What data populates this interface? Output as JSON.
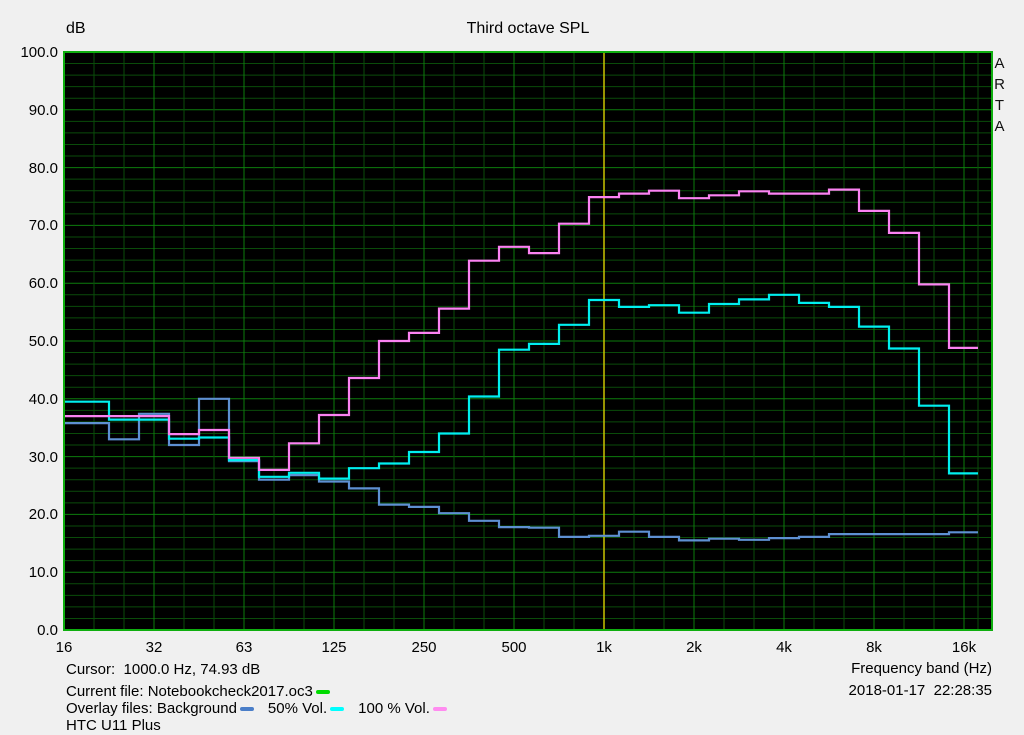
{
  "window": {
    "background": "#f0f0f0",
    "plot_background": "#000000"
  },
  "branding": {
    "vertical_label": "ARTA"
  },
  "chart_data": {
    "type": "step-line",
    "title": "Third octave SPL",
    "ylabel": "dB",
    "xlabel": "Frequency band (Hz)",
    "ylim": [
      0.0,
      100.0
    ],
    "grid": {
      "visible": true,
      "minor_color": "#0a4b0a",
      "major_color": "#0d7c0d",
      "border_color": "#0fae0f"
    },
    "y_tick_labels": [
      "100.0",
      "90.0",
      "80.0",
      "70.0",
      "60.0",
      "50.0",
      "40.0",
      "30.0",
      "20.0",
      "10.0",
      "0.0"
    ],
    "x_tick_labels": [
      "16",
      "32",
      "63",
      "125",
      "250",
      "500",
      "1k",
      "2k",
      "4k",
      "8k",
      "16k"
    ],
    "categories": [
      "16",
      "20",
      "25",
      "31.5",
      "40",
      "50",
      "63",
      "80",
      "100",
      "125",
      "160",
      "200",
      "250",
      "315",
      "400",
      "500",
      "630",
      "800",
      "1k",
      "1.25k",
      "1.6k",
      "2k",
      "2.5k",
      "3.15k",
      "4k",
      "5k",
      "6.3k",
      "8k",
      "10k",
      "12.5k",
      "16k"
    ],
    "series": [
      {
        "name": "Background",
        "color": "#5e90d2",
        "values": [
          35.8,
          35.8,
          33.0,
          37.4,
          32.0,
          40.0,
          29.2,
          26.0,
          26.8,
          25.7,
          24.5,
          21.7,
          21.3,
          20.2,
          18.9,
          17.8,
          17.7,
          16.1,
          16.3,
          17.0,
          16.1,
          15.5,
          15.8,
          15.6,
          15.9,
          16.1,
          16.6,
          16.6,
          16.6,
          16.6,
          16.9
        ]
      },
      {
        "name": "50% Vol.",
        "color": "#00efef",
        "values": [
          39.5,
          39.5,
          36.4,
          36.4,
          33.1,
          33.3,
          29.4,
          26.5,
          27.2,
          26.2,
          28.0,
          28.8,
          30.8,
          34.0,
          40.4,
          48.5,
          49.5,
          52.8,
          57.1,
          55.9,
          56.2,
          54.9,
          56.4,
          57.2,
          58.0,
          56.6,
          55.9,
          52.5,
          48.7,
          38.8,
          27.1
        ]
      },
      {
        "name": "100 % Vol.",
        "color": "#fb82f2",
        "values": [
          37.0,
          37.0,
          37.0,
          37.0,
          33.9,
          34.6,
          29.8,
          27.7,
          32.3,
          37.2,
          43.6,
          50.0,
          51.4,
          55.6,
          63.9,
          66.3,
          65.2,
          70.3,
          74.9,
          75.5,
          76.0,
          74.7,
          75.2,
          75.9,
          75.5,
          75.5,
          76.2,
          72.5,
          68.7,
          59.8,
          48.8
        ]
      }
    ],
    "cursor": {
      "frequency_hz": 1000.0,
      "value_db": 74.93,
      "color": "#c9c400"
    },
    "legend_position": "bottom-left-status"
  },
  "status": {
    "cursor_line": "Cursor:  1000.0 Hz, 74.93 dB",
    "current_file": {
      "label": "Current file: Notebookcheck2017.oc3",
      "swatch_color": "#00dc00"
    },
    "overlays": {
      "label": "Overlay files: Background",
      "swatch_color": "#4a7ec8",
      "items": [
        {
          "label": "50% Vol.",
          "swatch_color": "#00ffff"
        },
        {
          "label": "100 % Vol.",
          "swatch_color": "#ff8cf0"
        }
      ]
    },
    "device": "HTC U11 Plus",
    "frequency_band_label": "Frequency band (Hz)",
    "datetime": "2018-01-17  22:28:35"
  }
}
